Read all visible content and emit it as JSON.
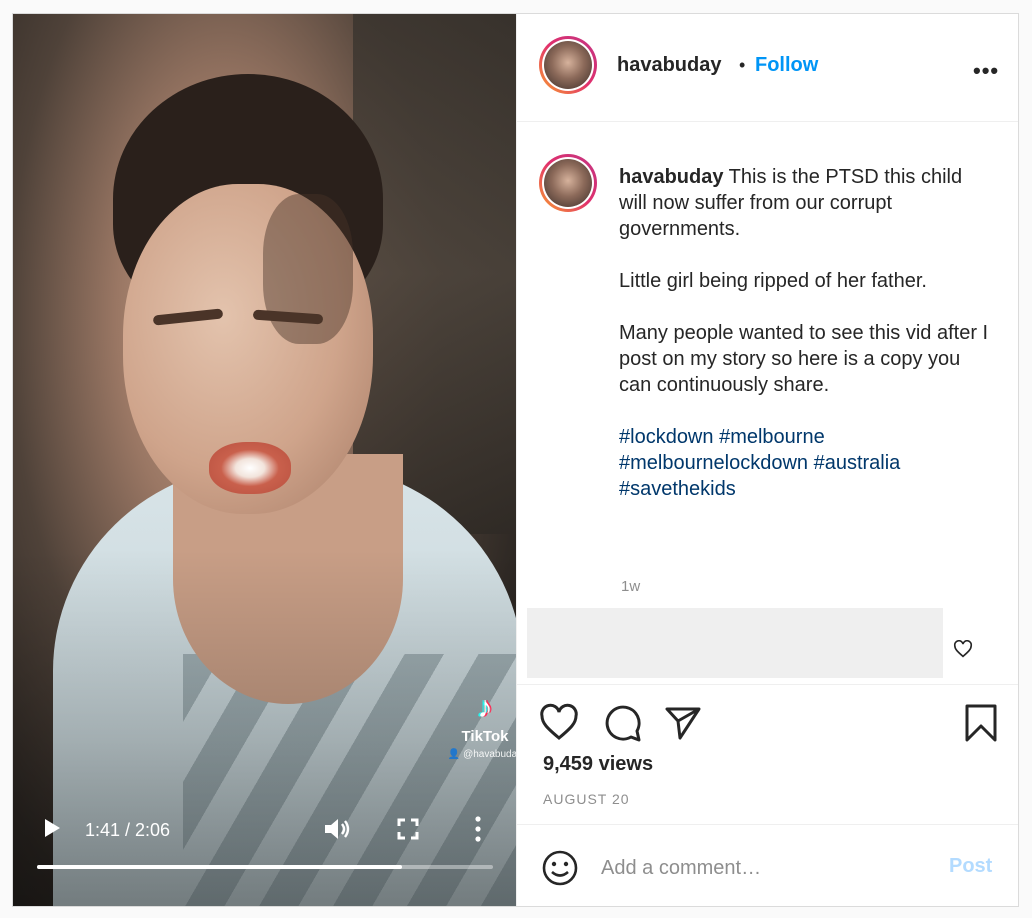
{
  "video": {
    "watermark": {
      "brand": "TikTok",
      "handle": "@havabuday",
      "icon": "tiktok-logo-icon"
    },
    "controls": {
      "time": "1:41 / 2:06",
      "progress_fraction": 0.8,
      "play_icon": "play-icon",
      "volume_icon": "volume-icon",
      "fullscreen_icon": "fullscreen-icon",
      "more_icon": "more-vertical-icon"
    }
  },
  "header": {
    "username": "havabuday",
    "separator": "•",
    "follow_label": "Follow",
    "options_label": "•••"
  },
  "caption": {
    "username": "havabuday",
    "body": " This is the PTSD this child will now suffer from our corrupt governments.\n\nLittle girl being ripped of her father.\n\nMany people wanted to see this vid after I post on my story so here is a copy you can continuously share.\n\n",
    "hashtags": [
      "#lockdown",
      "#melbourne",
      "#melbournelockdown",
      "#australia",
      "#savethekids"
    ],
    "time_ago": "1w"
  },
  "actions": {
    "views": "9,459 views",
    "date": "AUGUST 20"
  },
  "comment": {
    "placeholder": "Add a comment…",
    "post_label": "Post"
  },
  "colors": {
    "accent": "#0095f6",
    "hashtag": "#00376b",
    "muted": "#8e8e8e",
    "post_disabled": "#b3dbff"
  }
}
